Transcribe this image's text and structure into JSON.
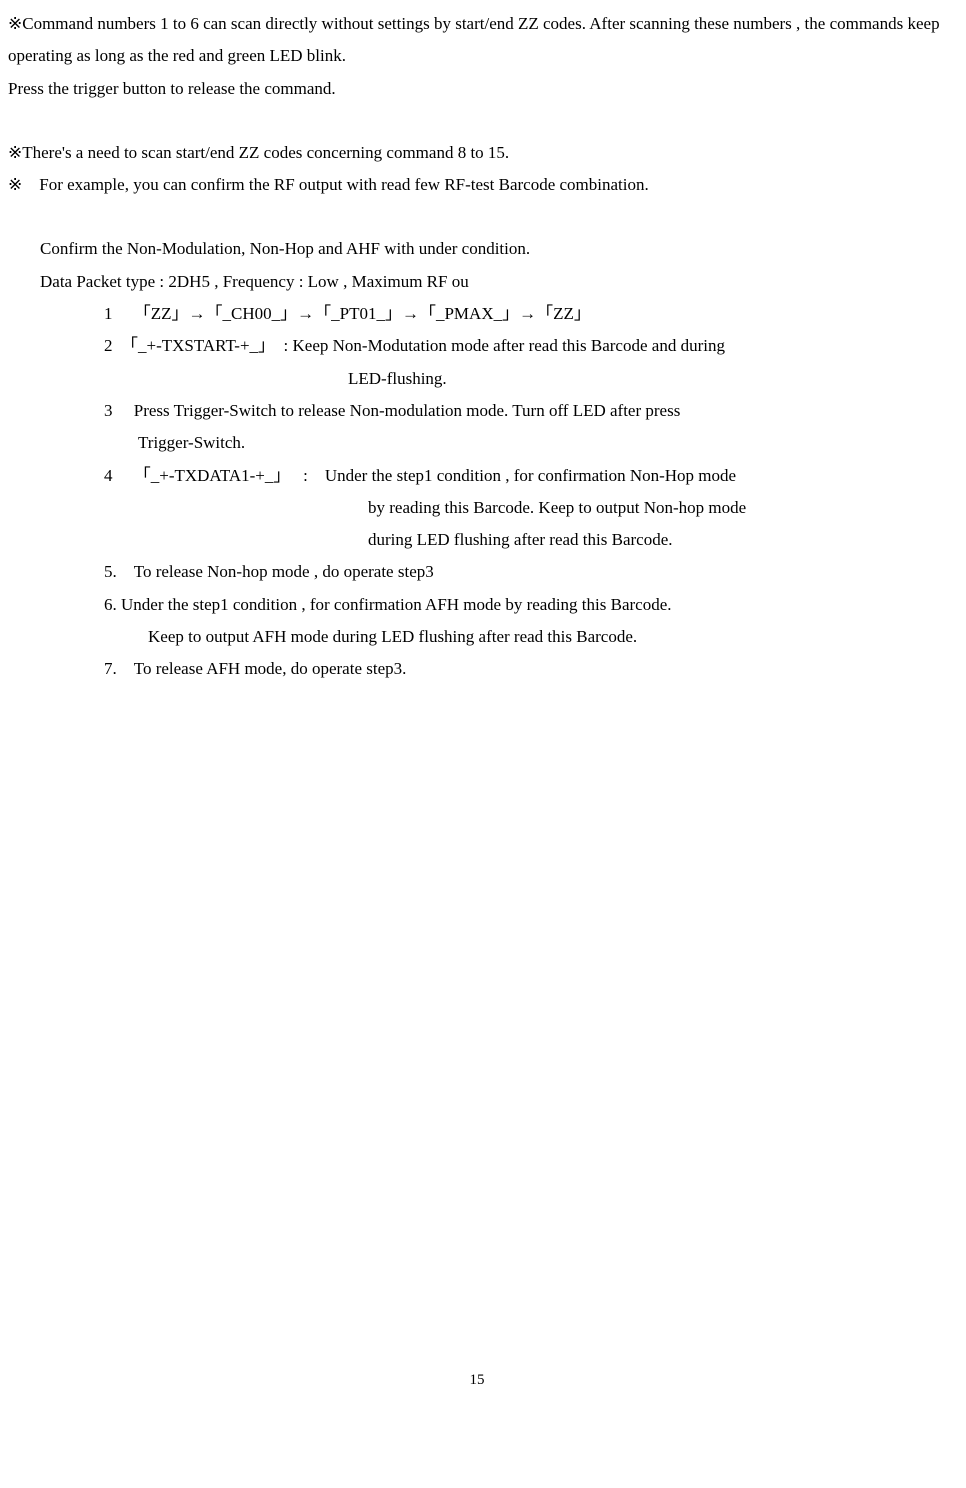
{
  "p1": "※Command numbers 1 to 6 can scan directly without settings by start/end ZZ codes. After scanning these numbers , the commands keep operating as long as the red and green LED blink.",
  "p2": "Press the trigger button to release the command.",
  "p3": "※There's a need to scan start/end ZZ codes concerning command 8 to 15.",
  "p4": "※　For example, you can confirm the RF output with read few RF-test Barcode combination.",
  "p5": "Confirm the Non-Modulation, Non-Hop and AHF with under condition.",
  "p6": "Data Packet type : 2DH5 , Frequency : Low , Maximum RF ou",
  "step1": "1　 「ZZ」→「_CH00_」→「_PT01_」→「_PMAX_」→「ZZ」",
  "step2": "2　「_+-TXSTART-+_」　: Keep Non-Modutation mode after read this Barcode and during",
  "step2b": "LED-flushing.",
  "step3": "3　 Press Trigger-Switch to release Non-modulation mode. Turn off LED after press",
  "step3b": "Trigger-Switch.",
  "step4": "4　 「_+-TXDATA1-+_」　 :　Under the step1 condition , for confirmation Non-Hop mode",
  "step4b": "by reading this Barcode. Keep to output Non-hop mode",
  "step4c": "during LED flushing after read this Barcode.",
  "step5": "5.　To release Non-hop mode , do operate step3",
  "step6": "6. Under the step1 condition , for confirmation AFH mode by reading this Barcode.",
  "step6b": "Keep to output AFH mode during LED flushing after read this Barcode.",
  "step7": "7.　To release AFH mode, do operate step3.",
  "page_number": "15"
}
